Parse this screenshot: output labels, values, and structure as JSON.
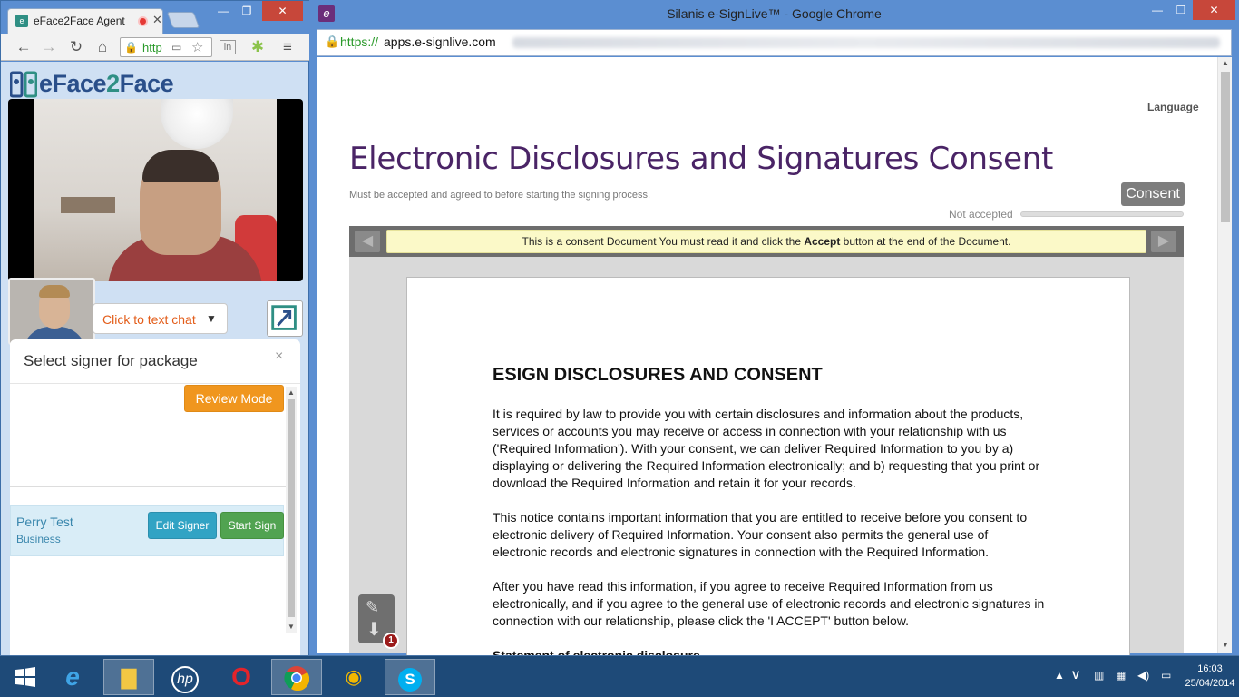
{
  "left_window": {
    "tab_title": "eFace2Face Agent",
    "url_scheme": "http",
    "brand_prefix": "eFace",
    "brand_two": "2",
    "brand_suffix": "Face",
    "chat_button_label": "Click to text chat",
    "signer_panel": {
      "title": "Select signer for package",
      "close": "×",
      "review_mode_label": "Review Mode",
      "signers": [
        {
          "name": "Perry Test",
          "role": "Business",
          "edit_label": "Edit Signer",
          "start_label": "Start Sign"
        }
      ]
    }
  },
  "right_window": {
    "window_title": "Silanis e-SignLive™ - Google Chrome",
    "url_scheme": "https://",
    "url_host": "apps.e-signlive.com",
    "language_label": "Language",
    "doc_title": "Electronic Disclosures and Signatures Consent",
    "doc_subtitle": "Must be accepted and agreed to before starting the signing process.",
    "consent_button": "Consent",
    "status_label": "Not accepted",
    "progress_fraction": 0.0,
    "notice_before": "This is a consent Document You must read it and click the ",
    "notice_bold": "Accept",
    "notice_after": " button at the end of the Document.",
    "document": {
      "heading": "ESIGN DISCLOSURES AND CONSENT",
      "paragraphs": [
        "It is required by law to provide you with certain disclosures and information about the products, services or accounts you may receive or access in connection with your relationship with us ('Required Information'). With your consent, we can deliver Required Information to you by a) displaying or delivering the Required Information electronically; and b) requesting that you print or download the Required Information and retain it for your records.",
        "This notice contains important information that you are entitled to receive before you consent to electronic delivery of Required Information. Your consent also permits the general use of electronic records and electronic signatures in connection with the Required Information.",
        "After you have read this information, if you agree to receive Required Information from us electronically, and if you agree to the general use of electronic records and electronic signatures in connection with our relationship, please click the 'I ACCEPT' button below.",
        "Statement of electronic disclosure"
      ]
    },
    "signature_badge_count": "1"
  },
  "taskbar": {
    "time": "16:03",
    "date": "25/04/2014"
  },
  "colors": {
    "title_purple": "#4a2466",
    "review_orange": "#f0961e",
    "edit_blue": "#31a3c4",
    "start_green": "#51a351",
    "notice_yellow": "#fbf9c8"
  },
  "icons": {
    "left_toolbar": [
      "back-icon",
      "forward-icon",
      "reload-icon",
      "home-icon",
      "lock-icon",
      "camera-icon",
      "star-icon",
      "linkedin-icon",
      "android-icon",
      "menu-icon"
    ],
    "taskbar": [
      "windows-start-icon",
      "internet-explorer-icon",
      "file-explorer-icon",
      "hp-icon",
      "opera-icon",
      "chrome-icon",
      "coin-icon",
      "skype-icon"
    ]
  }
}
